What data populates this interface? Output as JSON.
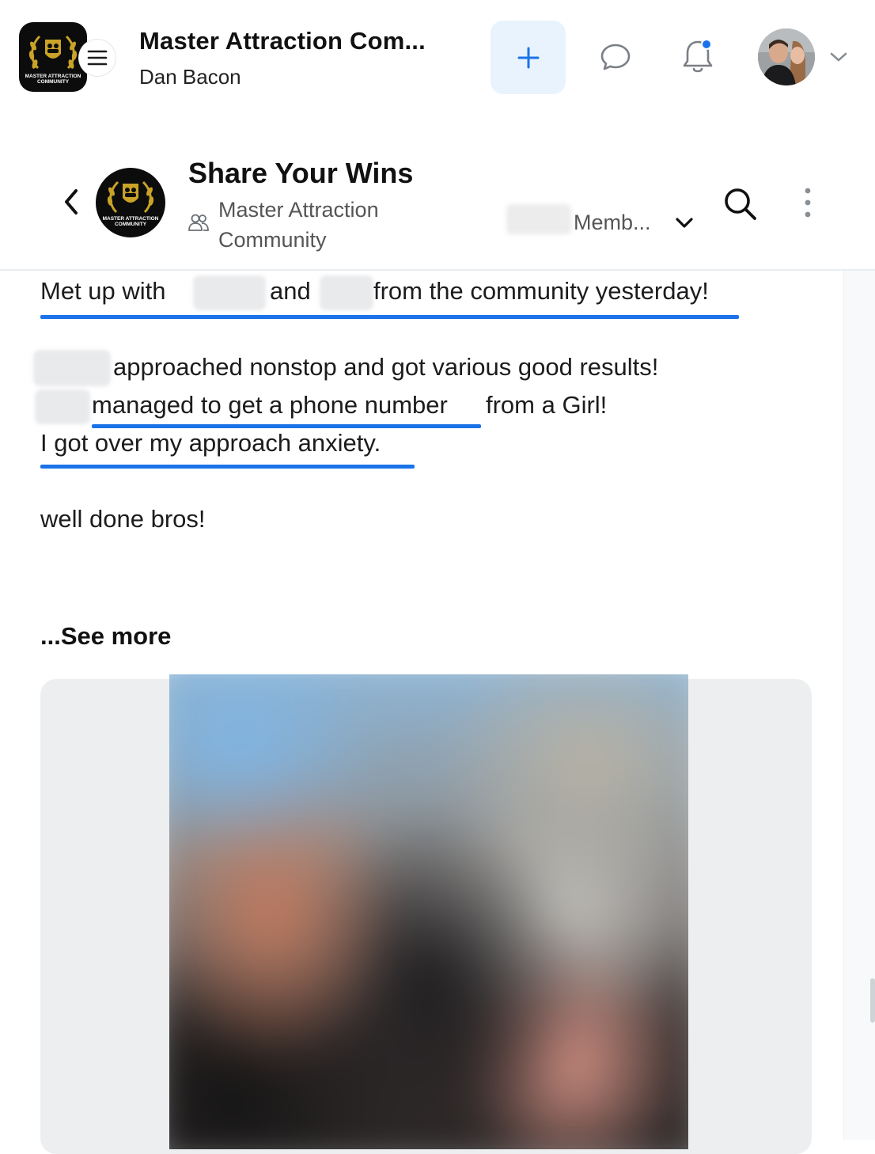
{
  "header": {
    "community_title": "Master Attraction Com...",
    "user_name": "Dan Bacon",
    "logo_text_line1": "MASTER ATTRACTION",
    "logo_text_line2": "COMMUNITY",
    "icons": {
      "menu": "hamburger-menu-icon",
      "create": "plus-icon",
      "chat": "chat-bubble-icon",
      "notifications": "bell-icon",
      "account_menu": "chevron-down-icon"
    },
    "notification_dot_color": "#1a73e8"
  },
  "space": {
    "title": "Share Your Wins",
    "community_name": "Master Attraction Community",
    "members_label": "Memb...",
    "icons": {
      "back": "chevron-left-icon",
      "community": "members-icon",
      "members_dropdown": "chevron-down-icon",
      "search": "search-icon",
      "more": "vertical-dots-icon"
    }
  },
  "post": {
    "line1_a": "Met up with",
    "line1_b": "and",
    "line1_c": "from the community yesterday!",
    "line2": "approached nonstop and got various good results!",
    "line3_a": "managed to get a phone number",
    "line3_b": "from a Girl!",
    "line4": "I got over my approach anxiety.",
    "line5": "well done bros!",
    "see_more": "...See more"
  },
  "colors": {
    "accent": "#1a73e8",
    "create_button_bg": "#e8f3fd"
  }
}
